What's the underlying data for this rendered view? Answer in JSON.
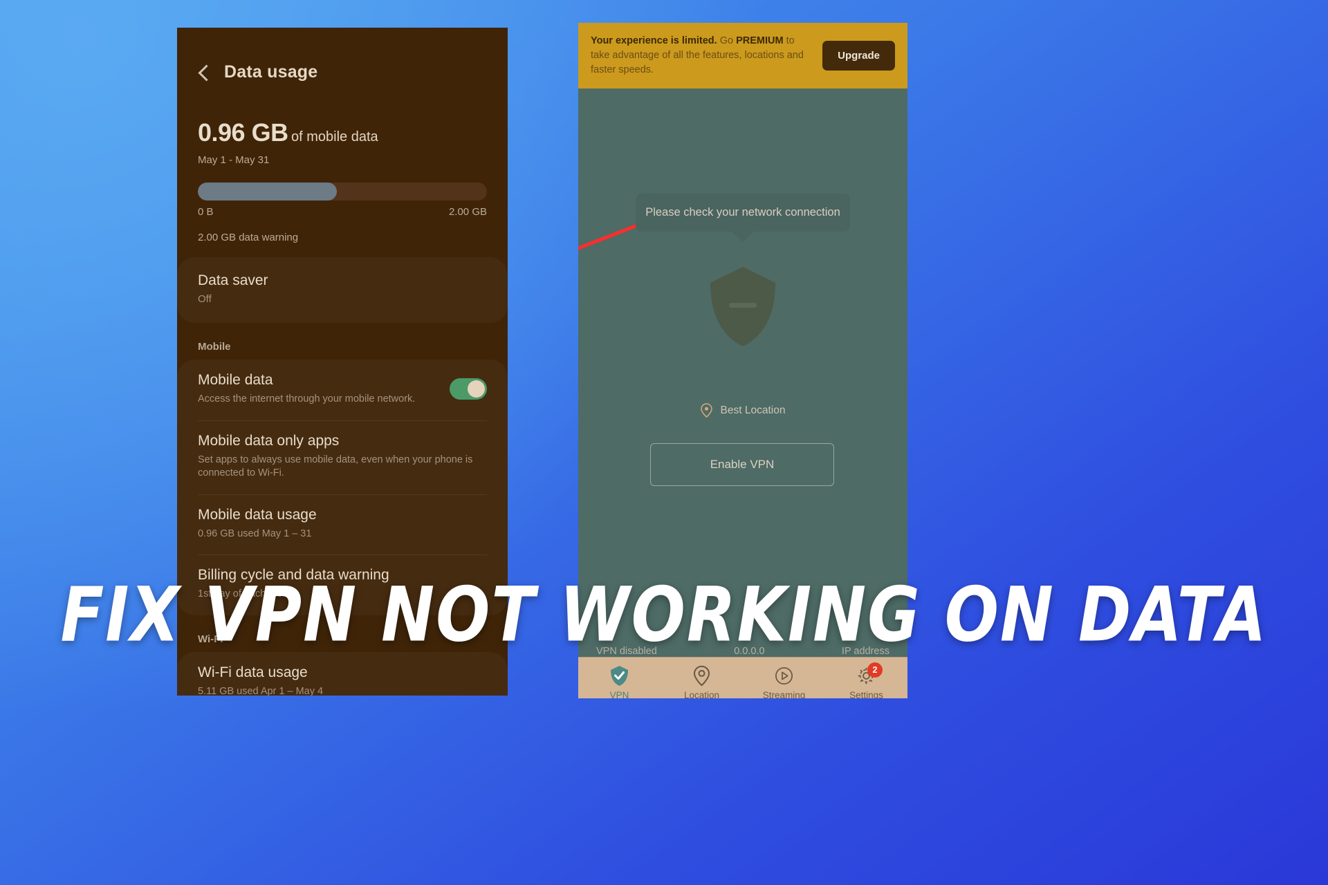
{
  "overlay": {
    "title": "FIX VPN NOT WORKING ON DATA"
  },
  "left_phone": {
    "appbar": {
      "back_icon": "chevron-left-icon",
      "title": "Data usage"
    },
    "usage": {
      "amount": "0.96 GB",
      "amount_suffix": "of mobile data",
      "range": "May 1 - May 31",
      "bar_min_label": "0 B",
      "bar_max_label": "2.00 GB",
      "bar_fill_percent": 48,
      "warning": "2.00 GB data warning"
    },
    "data_saver": {
      "title": "Data saver",
      "value": "Off"
    },
    "mobile_section_label": "Mobile",
    "rows": [
      {
        "title": "Mobile data",
        "sub": "Access the internet through your mobile network.",
        "toggle": "on"
      },
      {
        "title": "Mobile data only apps",
        "sub": "Set apps to always use mobile data, even when your phone is connected to Wi-Fi."
      },
      {
        "title": "Mobile data usage",
        "sub": "0.96 GB used May 1 – 31"
      },
      {
        "title": "Billing cycle and data warning",
        "sub": "1st day of each month"
      }
    ],
    "wifi_section_label": "Wi-Fi",
    "wifi_row": {
      "title": "Wi-Fi data usage",
      "sub": "5.11 GB used Apr 1 – May 4"
    }
  },
  "right_phone": {
    "promo": {
      "lead": "Your experience is limited.",
      "mid": " Go ",
      "premium": "PREMIUM",
      "tail": " to take advantage of all the features, locations and faster speeds.",
      "button": "Upgrade"
    },
    "tooltip": "Please check your network connection",
    "shield_icon": "shield-disabled-icon",
    "location": {
      "icon": "map-pin-icon",
      "label": "Best Location"
    },
    "enable_button": "Enable VPN",
    "status": {
      "left": "VPN disabled",
      "center": "0.0.0.0",
      "right": "IP address"
    },
    "tabs": [
      {
        "label": "VPN",
        "icon": "shield-check-icon",
        "active": true,
        "badge": ""
      },
      {
        "label": "Location",
        "icon": "map-pin-icon",
        "active": false,
        "badge": ""
      },
      {
        "label": "Streaming",
        "icon": "play-circle-icon",
        "active": false,
        "badge": ""
      },
      {
        "label": "Settings",
        "icon": "gear-icon",
        "active": false,
        "badge": "2"
      }
    ]
  },
  "colors": {
    "background_blue": "#3b79e8",
    "promo_gold": "#cc9a1d",
    "vpn_green": "#4e6b66",
    "tabbar_tan": "#d6b795",
    "badge_red": "#e23b25",
    "arrow_red": "#ff2d2d",
    "toggle_green": "#4c9a68"
  }
}
